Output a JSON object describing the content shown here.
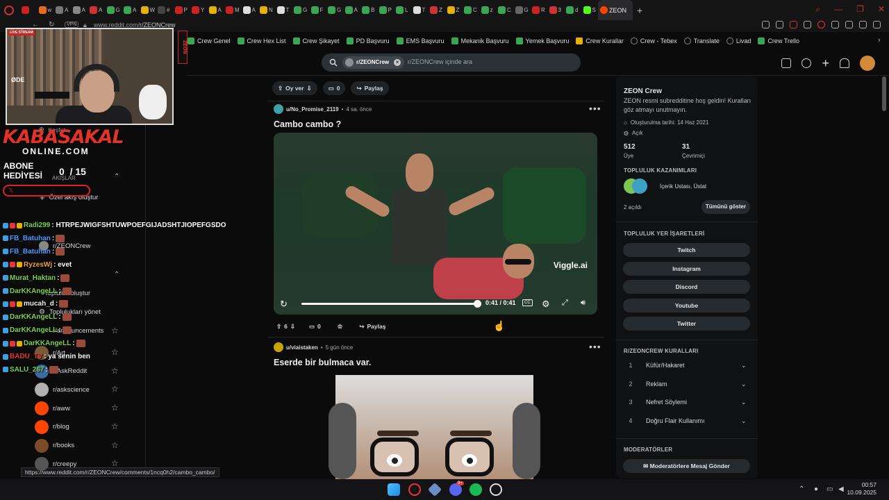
{
  "browser": {
    "tabs": [
      {
        "letter": "",
        "color": "#c22"
      },
      {
        "letter": "w",
        "color": "#e36c1f"
      },
      {
        "letter": "A",
        "color": "#777"
      },
      {
        "letter": "A",
        "color": "#888"
      },
      {
        "letter": "A",
        "color": "#c33"
      },
      {
        "letter": "G",
        "color": "#3aa655"
      },
      {
        "letter": "A",
        "color": "#3aa655"
      },
      {
        "letter": "W",
        "color": "#e6b100"
      },
      {
        "letter": "#",
        "color": "#444"
      },
      {
        "letter": "P",
        "color": "#c22"
      },
      {
        "letter": "Y",
        "color": "#c22"
      },
      {
        "letter": "A",
        "color": "#e6b100"
      },
      {
        "letter": "M",
        "color": "#c22"
      },
      {
        "letter": "A",
        "color": "#ddd"
      },
      {
        "letter": "N",
        "color": "#e6b100"
      },
      {
        "letter": "T",
        "color": "#ddd"
      },
      {
        "letter": "G",
        "color": "#3aa655"
      },
      {
        "letter": "F",
        "color": "#3aa655"
      },
      {
        "letter": "G",
        "color": "#3aa655"
      },
      {
        "letter": "A",
        "color": "#3aa655"
      },
      {
        "letter": "B",
        "color": "#3aa655"
      },
      {
        "letter": "P",
        "color": "#3aa655"
      },
      {
        "letter": "L",
        "color": "#3aa655"
      },
      {
        "letter": "T",
        "color": "#ddd"
      },
      {
        "letter": "Z",
        "color": "#c33"
      },
      {
        "letter": "Z",
        "color": "#e6b100"
      },
      {
        "letter": "C",
        "color": "#3aa655"
      },
      {
        "letter": "z",
        "color": "#3aa655"
      },
      {
        "letter": "C",
        "color": "#3aa655"
      },
      {
        "letter": "G",
        "color": "#666"
      },
      {
        "letter": "R",
        "color": "#c22"
      },
      {
        "letter": "3",
        "color": "#c33"
      },
      {
        "letter": "d",
        "color": "#3aa655"
      },
      {
        "letter": "S",
        "color": "#53fc18"
      }
    ],
    "active_tab_label": "ZEON",
    "vpn_label": "VPN",
    "url_prefix": "www.reddit.com/",
    "url_rest": "r/ZEONCrew",
    "status_url": "https://www.reddit.com/r/ZEONCrew/comments/1ncq0h2/cambo_cambo/"
  },
  "bookmarks": [
    {
      "label": "Crew Genel",
      "icon": "green"
    },
    {
      "label": "Crew Hex List",
      "icon": "green"
    },
    {
      "label": "Crew Şikayet",
      "icon": "green"
    },
    {
      "label": "PD Başvuru",
      "icon": "green"
    },
    {
      "label": "EMS Başvuru",
      "icon": "green"
    },
    {
      "label": "Mekanik Başvuru",
      "icon": "green"
    },
    {
      "label": "Yemek Başvuru",
      "icon": "green"
    },
    {
      "label": "Crew Kurallar",
      "icon": "yellow"
    },
    {
      "label": "Crew - Tebex",
      "icon": "arrow"
    },
    {
      "label": "Translate",
      "icon": "translate"
    },
    {
      "label": "Livad",
      "icon": "none"
    },
    {
      "label": "Crew Trello",
      "icon": "green"
    }
  ],
  "search": {
    "chip": "r/ZEONCrew",
    "placeholder": "r/ZEONCrew içinde ara"
  },
  "stream": {
    "live_label": "LIVE STREAM",
    "webcam_label": "ØDE",
    "side_badge": "ZEON",
    "logo_line1": "KABASAKAL",
    "logo_line2": "ONLINE.COM",
    "abone_label": "ABONE HEDİYESİ",
    "sub_count": "0  / 15"
  },
  "chat": [
    {
      "user": "Radi299",
      "msg": ": HTRPEJWIGFSHTUWPOEFGIJADSHTJIOPEFGSDO",
      "color": "#7cd14a"
    },
    {
      "user": "FB_Batuhan",
      "msg": ":",
      "color": "#4a9bff"
    },
    {
      "user": "FB_Batuhan",
      "msg": ":",
      "color": "#4a9bff"
    },
    {
      "user": "RyzesWj",
      "msg": ": evet",
      "color": "#e6a23a"
    },
    {
      "user": "Murat_Haktan",
      "msg": ":",
      "color": "#7cd14a"
    },
    {
      "user": "DarKKAngeLL",
      "msg": ":",
      "color": "#7cd14a"
    },
    {
      "user": "mucah_d",
      "msg": ":",
      "color": "#eeeeee"
    },
    {
      "user": "DarKKAngeLL",
      "msg": ":",
      "color": "#7cd14a"
    },
    {
      "user": "DarKKAngeLL",
      "msg": ":",
      "color": "#7cd14a"
    },
    {
      "user": "DarKKAngeLL",
      "msg": ":",
      "color": "#7cd14a"
    },
    {
      "user": "BADU_TV",
      "msg": ": ya senin ben",
      "color": "#e33"
    },
    {
      "user": "SALU_267",
      "msg": ":",
      "color": "#7cd14a"
    }
  ],
  "leftnav": {
    "kesfet": "Keşfet",
    "akislar": "AKIŞLAR",
    "custom_feed": "Özel akış oluştur",
    "zeoncrew": "r/ZEONCrew",
    "create_community": "Topluluk oluştur",
    "manage_communities": "Toplulukları yönet",
    "announcements": "r/announcements",
    "communities": [
      "r/Art",
      "r/AskReddit",
      "r/askscience",
      "r/aww",
      "r/blog",
      "r/books",
      "r/creepy"
    ]
  },
  "posts": [
    {
      "author": "u/No_Promise_2119",
      "time": "4 sa. önce",
      "title": "Cambo cambo ?",
      "votes": "6",
      "comments": "0",
      "share": "Paylaş",
      "video_time": "0:41 / 0:41",
      "progress": 1.0,
      "watermark": "Viggle.ai"
    },
    {
      "author": "u/viaistaken",
      "time": "5 gün önce",
      "title": "Eserde bir bulmaca var."
    }
  ],
  "top_actions": {
    "vote": "Oy ver",
    "comments": "0",
    "share": "Paylaş"
  },
  "sidebar": {
    "name": "ZEON Crew",
    "description": "ZEON resmi subredditine hoş geldin! Kuralları göz atmayı unutmayın.",
    "created": "Oluşturulma tarihi: 14 Haz 2021",
    "visibility": "Açık",
    "members": "512",
    "members_label": "Üye",
    "online": "31",
    "online_label": "Çevrimiçi",
    "achievements_heading": "TOPLULUK KAZANIMLARI",
    "achievements_text": "İçerik Ustası, Üstat",
    "unlocked": "2 açıldı",
    "show_all": "Tümünü göster",
    "bookmarks_heading": "TOPLULUK YER İŞARETLERİ",
    "bookmark_buttons": [
      "Twitch",
      "Instagram",
      "Discord",
      "Youtube",
      "Twitter"
    ],
    "rules_heading": "R/ZEONCREW KURALLARI",
    "rules": [
      {
        "n": "1",
        "t": "Küfür/Hakaret"
      },
      {
        "n": "2",
        "t": "Reklam"
      },
      {
        "n": "3",
        "t": "Nefret Söylemi"
      },
      {
        "n": "4",
        "t": "Doğru Flair Kullanımı"
      }
    ],
    "mods_heading": "MODERATÖRLER",
    "message_mods": "Moderatörlere Mesaj Gönder"
  },
  "taskbar": {
    "time": "00:57",
    "date": "10.09.2025",
    "discord_badge": "9+"
  }
}
